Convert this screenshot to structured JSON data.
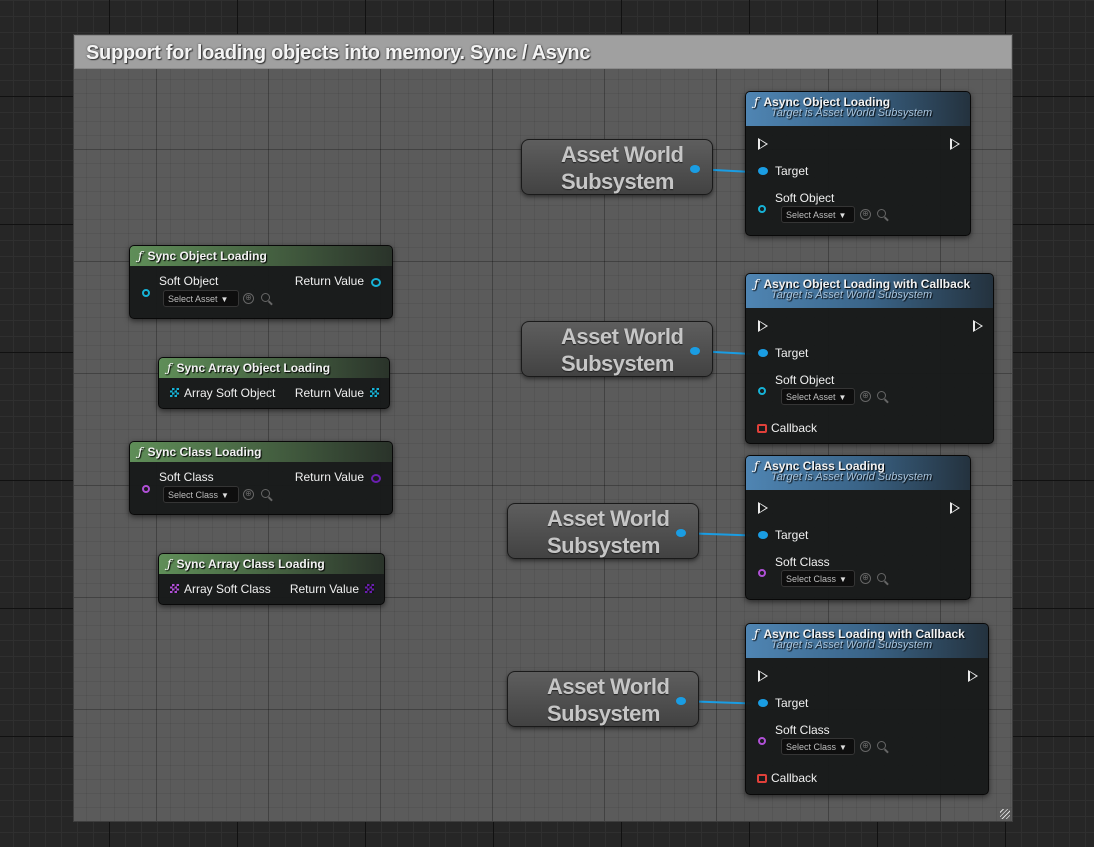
{
  "comment": {
    "title": "Support for loading objects into memory. Sync / Async"
  },
  "colors": {
    "object_pin": "#16b2d6",
    "class_pin": "#b050d6",
    "target_pin": "#1a9de3",
    "callback_pin": "#e0403a",
    "sync_header": "#5f8e58",
    "async_header": "#4f85b3"
  },
  "icons": {
    "function": "ƒ",
    "browse": "⊕",
    "chevron": "▼"
  },
  "sync_nodes": {
    "sync_object": {
      "title": "Sync Object Loading",
      "input": "Soft Object",
      "output": "Return Value",
      "select": "Select Asset"
    },
    "sync_array_object": {
      "title": "Sync Array Object Loading",
      "input": "Array Soft Object",
      "output": "Return Value"
    },
    "sync_class": {
      "title": "Sync Class Loading",
      "input": "Soft Class",
      "output": "Return Value",
      "select": "Select Class"
    },
    "sync_array_class": {
      "title": "Sync Array Class Loading",
      "input": "Array Soft Class",
      "output": "Return Value"
    }
  },
  "async_nodes": {
    "async_object": {
      "title": "Async Object Loading",
      "subtitle": "Target is Asset World Subsystem",
      "target": "Target",
      "input": "Soft Object",
      "select": "Select Asset"
    },
    "async_object_cb": {
      "title": "Async Object Loading with Callback",
      "subtitle": "Target is Asset World Subsystem",
      "target": "Target",
      "input": "Soft Object",
      "select": "Select Asset",
      "callback": "Callback"
    },
    "async_class": {
      "title": "Async Class Loading",
      "subtitle": "Target is Asset World Subsystem",
      "target": "Target",
      "input": "Soft Class",
      "select": "Select Class"
    },
    "async_class_cb": {
      "title": "Async Class Loading with Callback",
      "subtitle": "Target is Asset World Subsystem",
      "target": "Target",
      "input": "Soft Class",
      "select": "Select Class",
      "callback": "Callback"
    }
  },
  "variable_nodes": {
    "line1": "Asset World",
    "line2": "Subsystem"
  }
}
